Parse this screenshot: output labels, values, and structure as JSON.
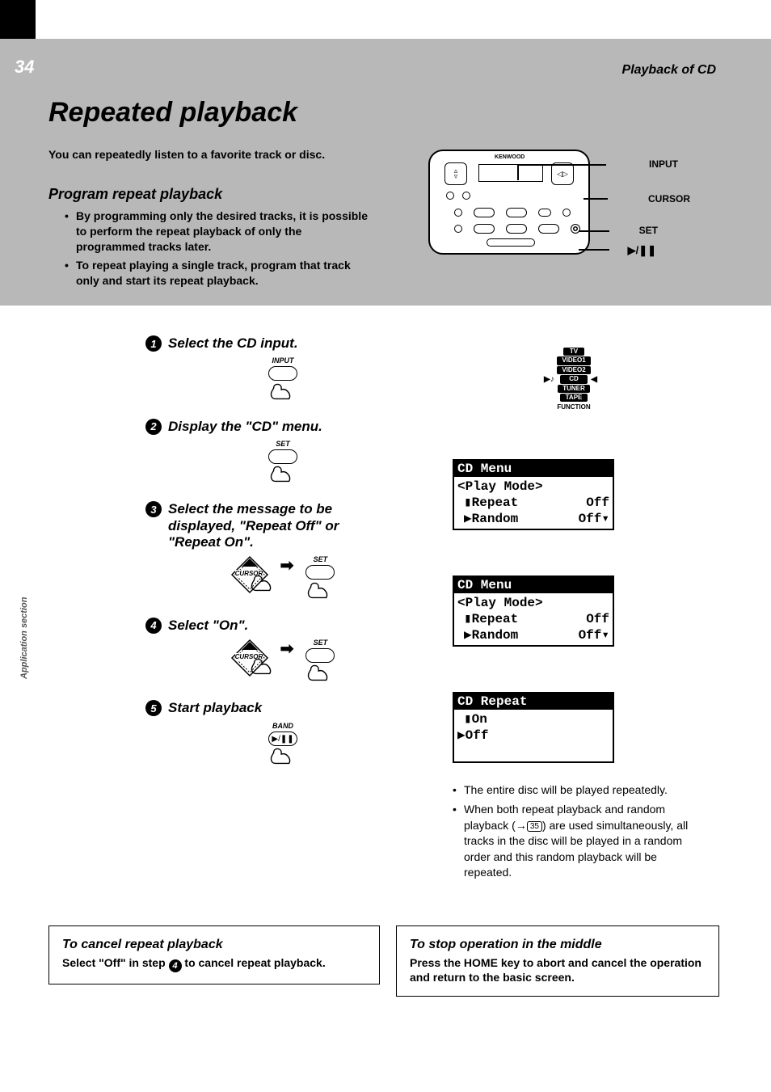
{
  "page_number": "34",
  "header_right": "Playback of CD",
  "title": "Repeated playback",
  "intro": "You can repeatedly listen to a favorite track or disc.",
  "subhead1": "Program repeat playback",
  "bullets1": [
    "By programming only the desired tracks, it is possible to perform the repeat playback of only the programmed tracks later.",
    "To repeat playing a single track, program that track only and start its repeat playback."
  ],
  "remote": {
    "brand": "KENWOOD",
    "labels": {
      "input": "INPUT",
      "cursor": "CURSOR",
      "set": "SET",
      "playpause": "▶/❚❚"
    }
  },
  "side_label": "Application section",
  "steps": {
    "s1": {
      "title": "Select the CD input.",
      "cap": "INPUT"
    },
    "s2": {
      "title": "Display the \"CD\" menu.",
      "cap": "SET"
    },
    "s3": {
      "title": "Select the message to be displayed, \"Repeat Off\" or \"Repeat On\".",
      "cap_cursor": "CURSOR",
      "cap_set": "SET"
    },
    "s4": {
      "title": "Select \"On\".",
      "cap_cursor": "CURSOR",
      "cap_set": "SET"
    },
    "s5": {
      "title": "Start playback",
      "cap": "BAND",
      "glyph": "▶/❚❚"
    }
  },
  "function_list": {
    "items": [
      "TV",
      "VIDEO1",
      "VIDEO2",
      "CD",
      "TUNER",
      "TAPE"
    ],
    "selected": "CD",
    "caption": "FUNCTION"
  },
  "lcd1": {
    "title": "CD Menu",
    "line1": "<Play Mode>",
    "row1_l": "▮Repeat",
    "row1_r": "Off",
    "row2_l": "▶Random",
    "row2_r": "Off▾"
  },
  "lcd2": {
    "title": "CD Menu",
    "line1": "<Play Mode>",
    "row1_l": "▮Repeat",
    "row1_r": "Off",
    "row2_l": "▶Random",
    "row2_r": "Off▾"
  },
  "lcd3": {
    "title": "CD Repeat",
    "row1": "▮On",
    "row2": "▶Off"
  },
  "notes": {
    "n1": "The entire disc will be played repeatedly.",
    "n2a": "When both repeat playback and random playback (",
    "n2_ref": "35",
    "n2b": ") are used simultaneously, all tracks in the disc will be played in a random order and this random playback will be repeated."
  },
  "box_left": {
    "head": "To cancel repeat playback",
    "body_a": "Select \"Off\" in step ",
    "body_num": "4",
    "body_b": " to cancel repeat playback."
  },
  "box_right": {
    "head": "To stop operation in the middle",
    "body": "Press the HOME key to abort and cancel the operation and return to the basic screen."
  }
}
